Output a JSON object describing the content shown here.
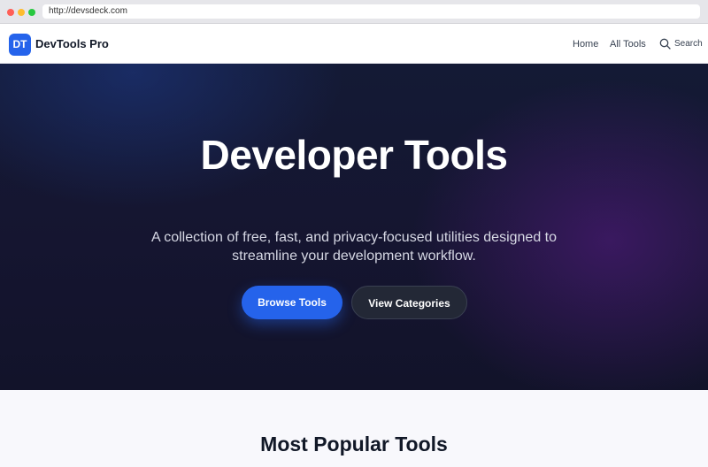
{
  "browser": {
    "url": "http://devsdeck.com"
  },
  "navbar": {
    "logo_text": "DT",
    "brand": "DevTools Pro",
    "links": [
      {
        "label": "Home"
      },
      {
        "label": "All Tools"
      }
    ],
    "search_label": "Search",
    "search_icon": "search-icon"
  },
  "hero": {
    "title": "Developer Tools",
    "subtitle": "A collection of free, fast, and privacy-focused utilities designed to streamline your development workflow.",
    "primary_button": "Browse Tools",
    "secondary_button": "View Categories"
  },
  "popular": {
    "title": "Most Popular Tools"
  },
  "colors": {
    "accent": "#2563eb",
    "hero_bg": "#141a35",
    "section_bg": "#f8f8fc"
  }
}
